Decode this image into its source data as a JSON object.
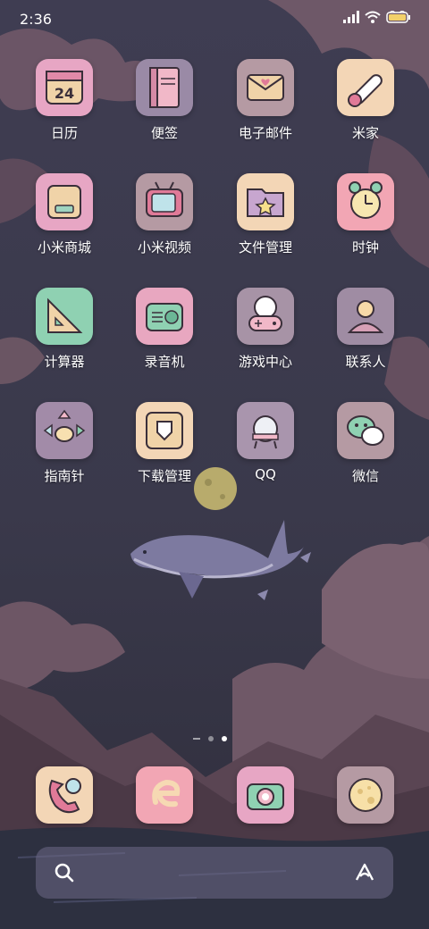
{
  "status_bar": {
    "time": "2:36",
    "battery_color": "#f3d16a"
  },
  "apps": [
    {
      "name": "app-calendar",
      "label": "日历",
      "icon": "calendar-icon",
      "bg": "#e7a6c4"
    },
    {
      "name": "app-notes",
      "label": "便签",
      "icon": "notes-book-icon",
      "bg": "#9a8aa6"
    },
    {
      "name": "app-email",
      "label": "电子邮件",
      "icon": "mail-icon",
      "bg": "#b59aa3"
    },
    {
      "name": "app-mijia",
      "label": "米家",
      "icon": "thermometer-icon",
      "bg": "#f3d6b6"
    },
    {
      "name": "app-mi-store",
      "label": "小米商城",
      "icon": "store-bag-icon",
      "bg": "#e7a6c4"
    },
    {
      "name": "app-mi-video",
      "label": "小米视频",
      "icon": "tv-icon",
      "bg": "#b59aa3"
    },
    {
      "name": "app-file-manager",
      "label": "文件管理",
      "icon": "folder-star-icon",
      "bg": "#f3d6b6"
    },
    {
      "name": "app-clock",
      "label": "时钟",
      "icon": "alarm-clock-icon",
      "bg": "#f2a6b4"
    },
    {
      "name": "app-calculator",
      "label": "计算器",
      "icon": "calculator-ruler-icon",
      "bg": "#8fd1b2"
    },
    {
      "name": "app-recorder",
      "label": "录音机",
      "icon": "radio-icon",
      "bg": "#e8a7c0"
    },
    {
      "name": "app-game-center",
      "label": "游戏中心",
      "icon": "gamepad-icon",
      "bg": "#a793a6"
    },
    {
      "name": "app-contacts",
      "label": "联系人",
      "icon": "contact-person-icon",
      "bg": "#9f8ca3"
    },
    {
      "name": "app-compass",
      "label": "指南针",
      "icon": "compass-arrows-icon",
      "bg": "#a28ba8"
    },
    {
      "name": "app-download-manager",
      "label": "下载管理",
      "icon": "download-tray-icon",
      "bg": "#f3d6b6"
    },
    {
      "name": "app-qq",
      "label": "QQ",
      "icon": "qq-penguin-icon",
      "bg": "#a995ad"
    },
    {
      "name": "app-wechat",
      "label": "微信",
      "icon": "wechat-bubbles-icon",
      "bg": "#b59aa3"
    }
  ],
  "dock": [
    {
      "name": "dock-phone",
      "icon": "phone-icon",
      "bg": "#f3d6b6"
    },
    {
      "name": "dock-browser",
      "icon": "browser-e-icon",
      "bg": "#f2a6b4"
    },
    {
      "name": "dock-camera",
      "icon": "camera-icon",
      "bg": "#e7a6c4"
    },
    {
      "name": "dock-themes",
      "icon": "moon-planet-icon",
      "bg": "#b59aa3"
    }
  ],
  "page_indicator": {
    "pages": 2,
    "current": 2
  },
  "search_bar": {
    "left_icon": "search-icon",
    "right_icon": "assistant-a-icon"
  }
}
